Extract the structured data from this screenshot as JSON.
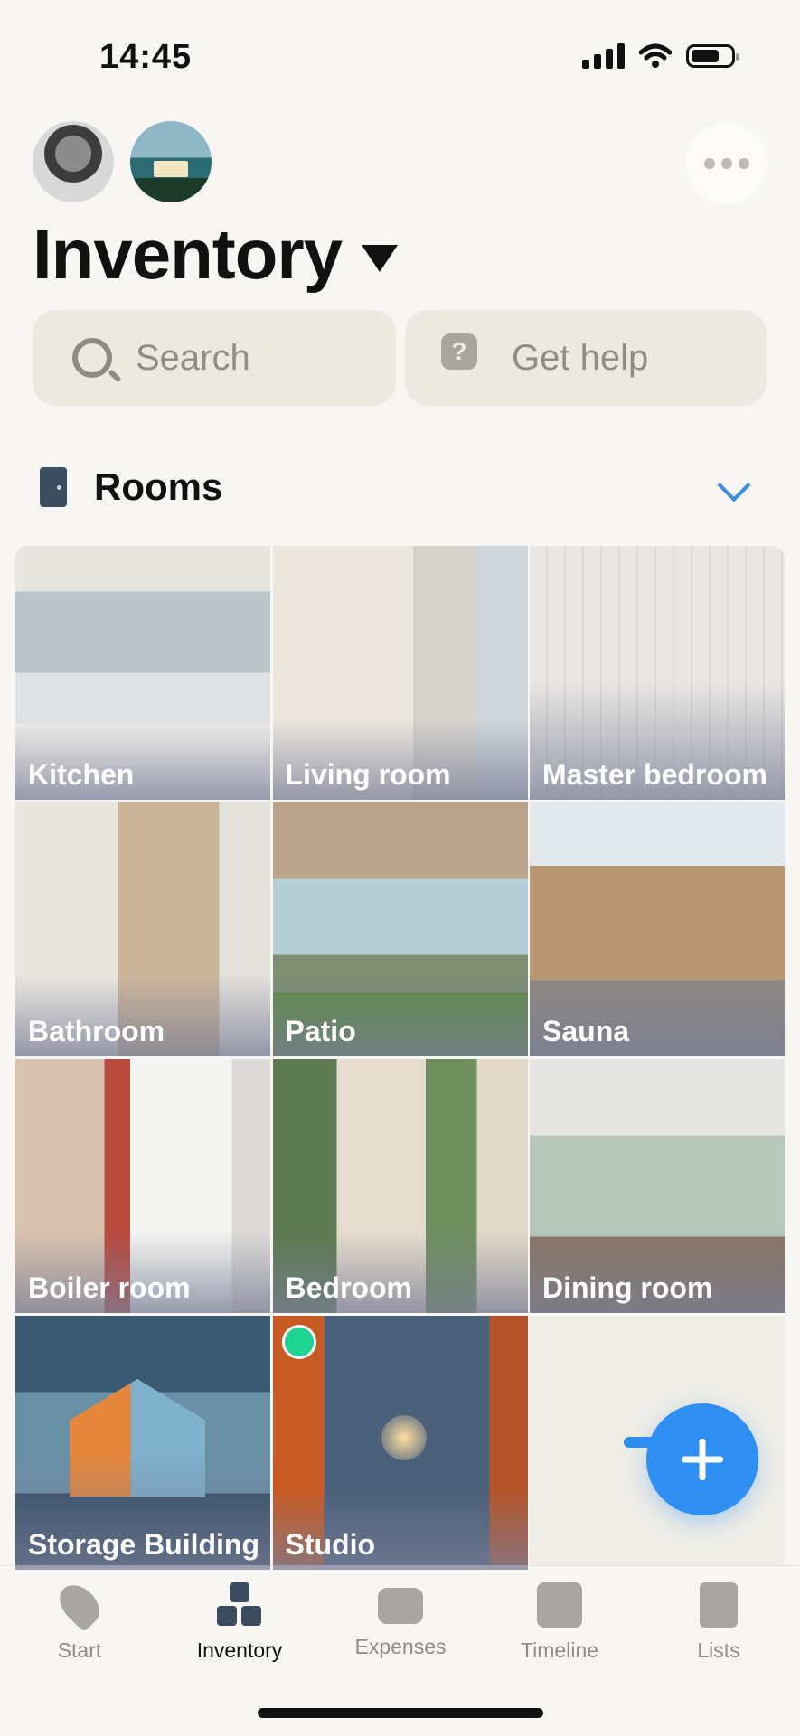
{
  "status_bar": {
    "time": "14:45"
  },
  "header": {
    "title": "Inventory"
  },
  "search": {
    "placeholder": "Search"
  },
  "help": {
    "label": "Get help"
  },
  "rooms": {
    "title": "Rooms",
    "tiles": [
      "Kitchen",
      "Living room",
      "Master bedroom",
      "Bathroom",
      "Patio",
      "Sauna",
      "Boiler room",
      "Bedroom",
      "Dining room",
      "Storage Building",
      "Studio"
    ]
  },
  "tabbar": {
    "items": [
      "Start",
      "Inventory",
      "Expenses",
      "Timeline",
      "Lists"
    ],
    "active": "Inventory"
  },
  "colors": {
    "accent": "#2f8ff2",
    "badge": "#1ed492",
    "nav_active": "#3c4c60"
  }
}
